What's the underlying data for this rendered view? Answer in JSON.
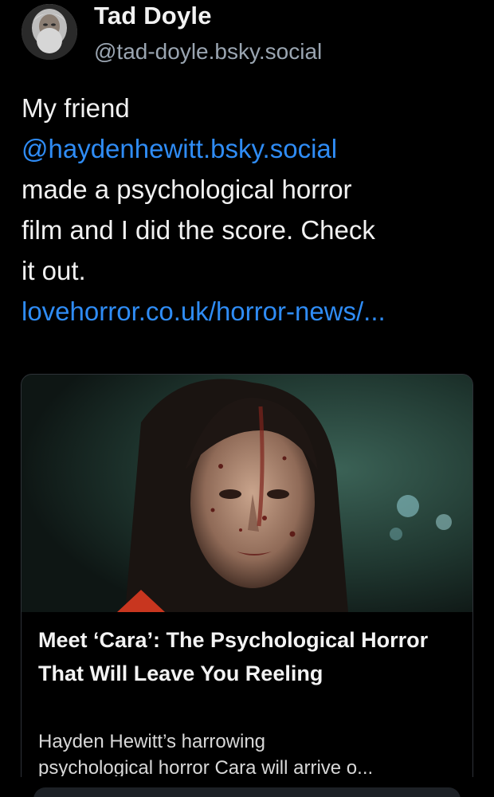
{
  "post": {
    "author": {
      "display_name": "Tad Doyle",
      "handle": "@tad-doyle.bsky.social"
    },
    "text": {
      "line1": "My friend",
      "mention": "@haydenhewitt.bsky.social",
      "line3": "made a psychological horror",
      "line4": "film and I did the score. Check",
      "line5": "it out.",
      "link": "lovehorror.co.uk/horror-news/..."
    }
  },
  "link_card": {
    "title": "Meet ‘Cara’: The Psychological Horror That Will Leave You Reeling",
    "description_line1": "Hayden Hewitt’s harrowing",
    "description_line2": "psychological horror Cara will arrive o..."
  },
  "colors": {
    "background": "#000000",
    "link": "#2f8cf5",
    "handle": "#9aa5b1",
    "card_border": "#2e3238"
  },
  "icons": {
    "avatar": "author-avatar",
    "card_image": "film-still-image"
  }
}
